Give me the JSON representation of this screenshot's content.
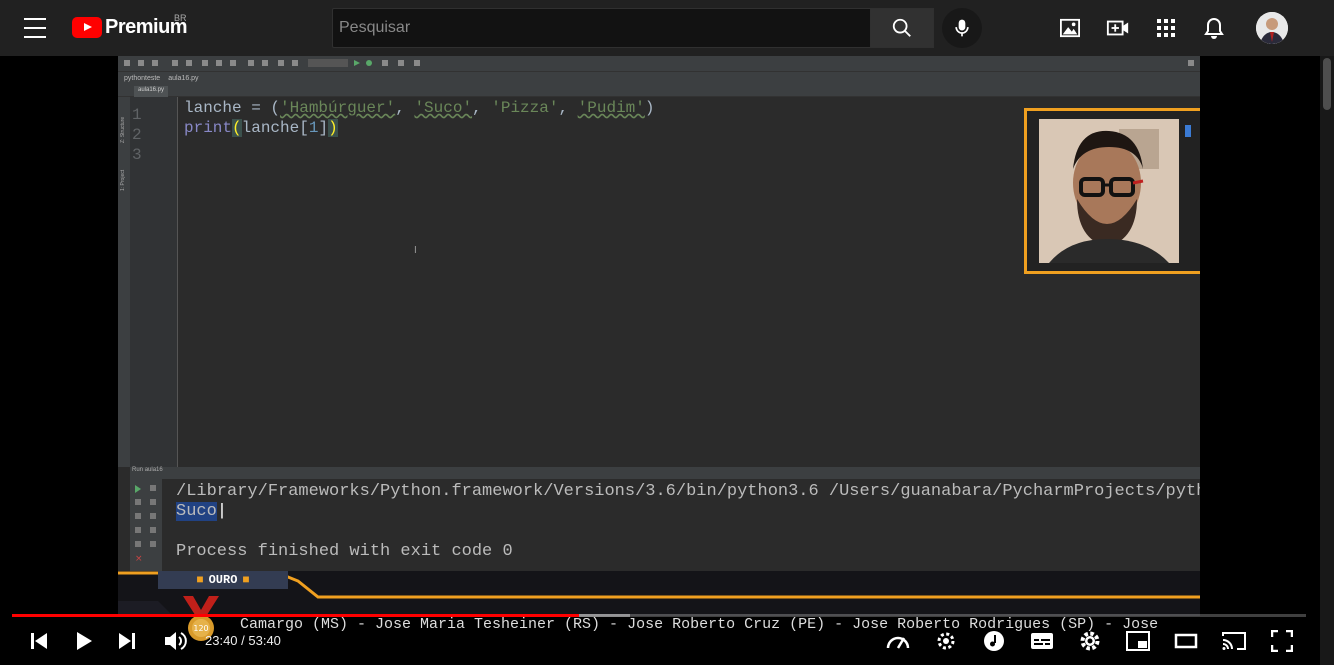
{
  "header": {
    "logo_text": "Premium",
    "logo_region": "BR",
    "search_placeholder": "Pesquisar"
  },
  "ide": {
    "crumbs": [
      "pythonteste",
      "aula16.py"
    ],
    "toolbar_config": "aula16",
    "tab": "aula16.py",
    "side_labels": [
      "Z: Structure",
      "1: Project"
    ],
    "line_numbers": [
      "1",
      "2",
      "3"
    ],
    "code": {
      "line1_var": "lanche = (",
      "line1_s1": "'Hambúrguer'",
      "line1_s2": "'Suco'",
      "line1_s3": "'Pizza'",
      "line1_s4": "'Pudim'",
      "line2_kw": "print",
      "line2_arg": "lanche[",
      "line2_idx": "1",
      "line2_close": "]"
    },
    "run_label": "Run",
    "run_config": "aula16",
    "console": {
      "line1": "/Library/Frameworks/Python.framework/Versions/3.6/bin/python3.6 /Users/guanabara/PycharmProjects/pyth",
      "line2": "Suco",
      "line3": "Process finished with exit code 0"
    }
  },
  "banner": {
    "tier": "OURO",
    "medal_number": "120",
    "ticker": "Camargo (MS) - Jose Maria Tesheiner (RS) - Jose Roberto Cruz (PE) - Jose Roberto Rodrigues (SP) - Jose"
  },
  "player": {
    "time": "23:40 / 53:40",
    "progress": 0.4385,
    "buffered": 0.4775
  },
  "colors": {
    "accent": "#ff0000",
    "header_bg": "#212121",
    "webcam_border": "#f0a020"
  }
}
